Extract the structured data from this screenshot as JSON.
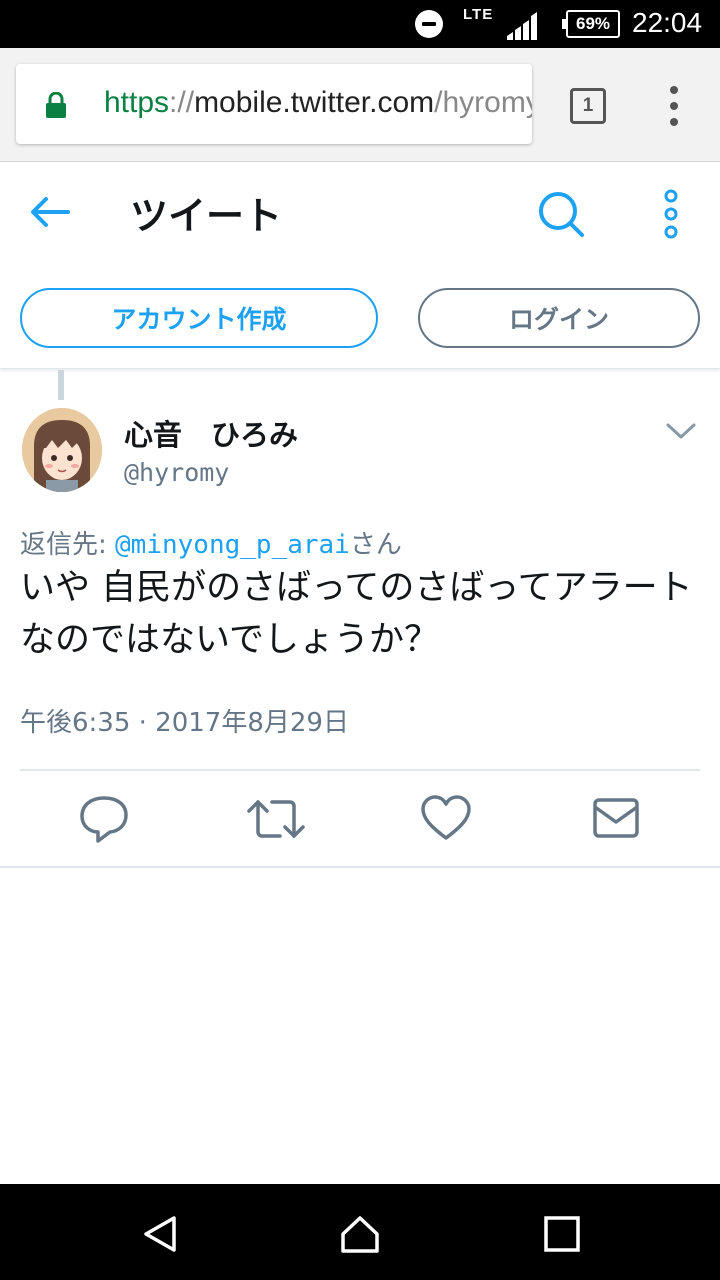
{
  "status_bar": {
    "lte_label": "LTE",
    "battery": "69%",
    "time": "22:04"
  },
  "browser": {
    "url_scheme": "https",
    "url_sep": "://",
    "url_host": "mobile.twitter.com",
    "url_path": "/hyromy",
    "tab_count": "1",
    "secure_color": "#0b8043"
  },
  "header": {
    "title": "ツイート",
    "icons": [
      "back-arrow-icon",
      "search-icon",
      "more-vertical-icon"
    ],
    "accent": "#1da1f2"
  },
  "auth": {
    "signup_label": "アカウント作成",
    "login_label": "ログイン"
  },
  "tweet": {
    "display_name": "心音　ひろみ",
    "handle": "@hyromy",
    "reply_prefix": "返信先: ",
    "reply_mention": "@minyong_p_arai",
    "reply_suffix": "さん",
    "text": "いや 自民がのさばってのさばってアラートなのではないでしょうか？",
    "timestamp": "午後6:35 · 2017年8月29日",
    "actions": [
      "reply-icon",
      "retweet-icon",
      "like-icon",
      "direct-message-icon"
    ]
  },
  "nav": {
    "buttons": [
      "back-triangle-icon",
      "home-icon",
      "recents-icon"
    ]
  }
}
